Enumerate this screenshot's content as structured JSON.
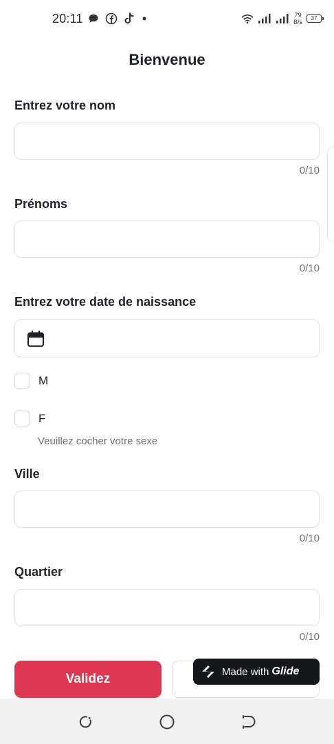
{
  "status_bar": {
    "time": "20:11",
    "left_icons": [
      "chat-bubble-icon",
      "facebook-icon",
      "tiktok-icon",
      "dot-icon"
    ],
    "right_icons": [
      "wifi-icon",
      "signal-icon",
      "signal-icon"
    ],
    "speed_value": "79",
    "speed_unit": "B/s",
    "battery": "37"
  },
  "header": {
    "title": "Bienvenue"
  },
  "form": {
    "nom": {
      "label": "Entrez votre nom",
      "value": "",
      "counter": "0/10"
    },
    "prenoms": {
      "label": "Prénoms",
      "value": "",
      "counter": "0/10"
    },
    "date": {
      "label": "Entrez votre date de naissance",
      "icon": "calendar-icon"
    },
    "sexe": {
      "options": [
        {
          "label": "M",
          "checked": false
        },
        {
          "label": "F",
          "checked": false
        }
      ],
      "hint": "Veuillez cocher votre sexe"
    },
    "ville": {
      "label": "Ville",
      "value": "",
      "counter": "0/10"
    },
    "quartier": {
      "label": "Quartier",
      "value": "",
      "counter": "0/10"
    }
  },
  "actions": {
    "submit_label": "Validez",
    "badge_prefix": "Made with",
    "badge_brand": "Glide"
  },
  "nav_bar": {
    "buttons": [
      "recent-apps-icon",
      "home-icon",
      "back-icon"
    ]
  },
  "colors": {
    "accent": "#dc3651",
    "badge_bg": "#15171a",
    "border": "#dfe1e5",
    "muted_text": "#6b7078"
  }
}
